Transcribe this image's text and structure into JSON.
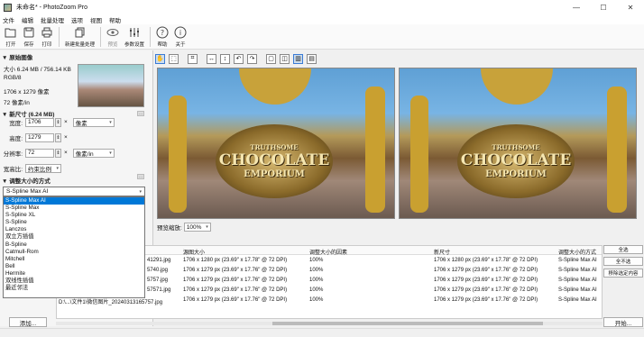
{
  "window": {
    "title": "未命名* - PhotoZoom Pro",
    "minimize": "—",
    "maximize": "☐",
    "close": "✕"
  },
  "menu": [
    "文件",
    "编辑",
    "批量处理",
    "选项",
    "视图",
    "帮助"
  ],
  "toolbar": [
    {
      "label": "打开",
      "icon": "folder-open-icon"
    },
    {
      "label": "保存",
      "icon": "save-icon"
    },
    {
      "label": "打印",
      "icon": "print-icon"
    },
    {
      "label": "新建批量处理",
      "icon": "batch-icon"
    },
    {
      "label": "预览",
      "icon": "eye-icon"
    },
    {
      "label": "参数设置",
      "icon": "sliders-icon"
    },
    {
      "label": "帮助",
      "icon": "help-icon"
    },
    {
      "label": "关于",
      "icon": "info-icon"
    }
  ],
  "left": {
    "source_header": "▼ 原始图像",
    "size_line": "大小 6.24 MB / 756.14 KB",
    "color_mode": "RGB/8",
    "pixels": "1706 x 1279 像素",
    "resolution": "72 像素/in",
    "newsize_header": "▼ 新尺寸 (6.24 MB)",
    "width_label": "宽度:",
    "width_value": "1706",
    "width_unit": "像素",
    "height_label": "高度:",
    "height_value": "1279",
    "res_label": "分辨率:",
    "res_value": "72",
    "res_unit": "像素/in",
    "ratio_label": "宽高比:",
    "ratio_value": "约束比例",
    "method_header": "▼ 调整大小的方式",
    "method_value": "S-Spline Max AI",
    "methods": [
      "S-Spline Max AI",
      "S-Spline Max",
      "S-Spline XL",
      "S-Spline",
      "Lanczos",
      "双立方插值",
      "B-Spline",
      "Catmull-Rom",
      "Mitchell",
      "Bell",
      "Hermite",
      "双线性插值",
      "最近邻法"
    ]
  },
  "preview": {
    "zoom_label": "预览缩放:",
    "zoom_value": "100%",
    "sign_top": "TRUTHSOME",
    "sign_mid": "CHOCOLATE",
    "sign_bottom": "EMPORIUM"
  },
  "table": {
    "headers": [
      "源图大小",
      "调整大小的因素",
      "新尺寸",
      "调整大小的方式"
    ],
    "rows": [
      {
        "file": "41291.jpg",
        "src": "1706 x 1280 px (23.69\" x 17.78\" @ 72 DPI)",
        "factor": "100%",
        "new": "1706 x 1280 px (23.69\" x 17.78\" @ 72 DPI)",
        "method": "S-Spline Max AI"
      },
      {
        "file": "5740.jpg",
        "src": "1706 x 1279 px (23.69\" x 17.76\" @ 72 DPI)",
        "factor": "100%",
        "new": "1706 x 1279 px (23.69\" x 17.76\" @ 72 DPI)",
        "method": "S-Spline Max AI"
      },
      {
        "file": "5757.jpg",
        "src": "1706 x 1279 px (23.69\" x 17.76\" @ 72 DPI)",
        "factor": "100%",
        "new": "1706 x 1279 px (23.69\" x 17.76\" @ 72 DPI)",
        "method": "S-Spline Max AI"
      },
      {
        "file": "57571.jpg",
        "src": "1706 x 1279 px (23.69\" x 17.76\" @ 72 DPI)",
        "factor": "100%",
        "new": "1706 x 1279 px (23.69\" x 17.76\" @ 72 DPI)",
        "method": "S-Spline Max AI"
      },
      {
        "file": "D:\\...\\文件1\\微信图片_20240313165757.jpg",
        "src": "1706 x 1279 px (23.69\" x 17.76\" @ 72 DPI)",
        "factor": "100%",
        "new": "1706 x 1279 px (23.69\" x 17.76\" @ 72 DPI)",
        "method": "S-Spline Max AI"
      }
    ]
  },
  "buttons": {
    "select_all": "全选",
    "select_none": "全不选",
    "remove_selected": "移除选定内容",
    "add": "添加...",
    "start": "开始..."
  }
}
